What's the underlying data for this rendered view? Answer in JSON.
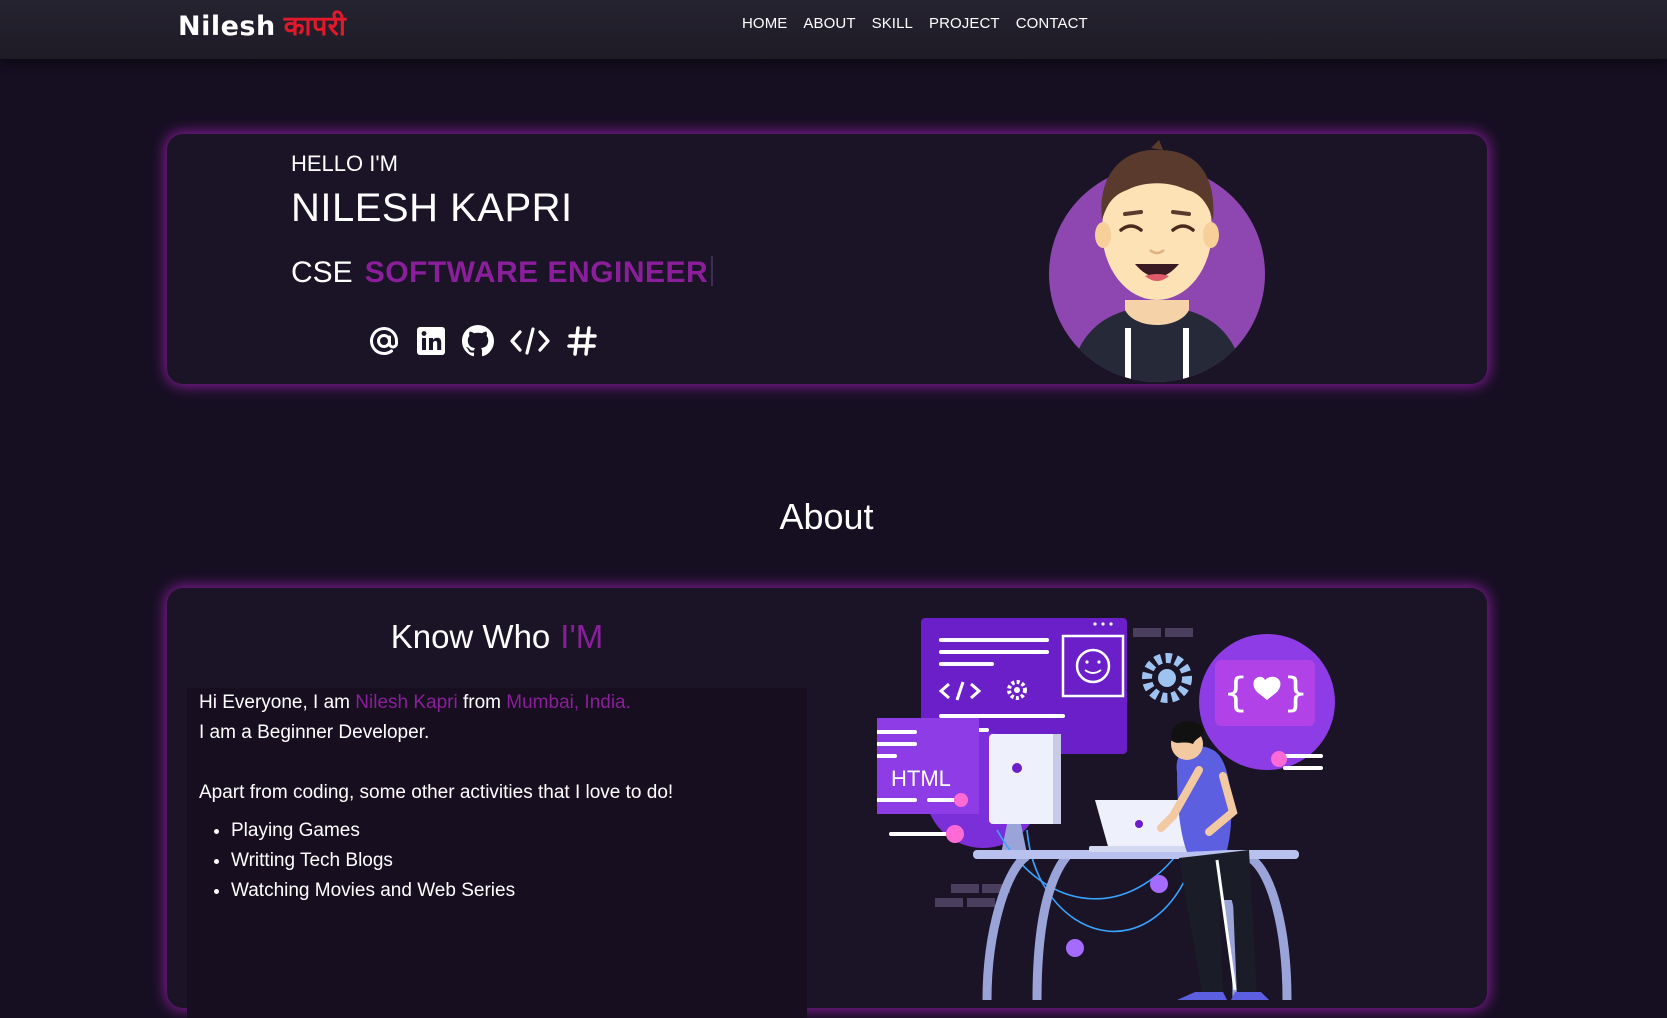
{
  "brand": {
    "first": "Nilesh",
    "last": "कापरी"
  },
  "nav": [
    "HOME",
    "ABOUT",
    "SKILL",
    "PROJECT",
    "CONTACT"
  ],
  "hero": {
    "greeting": "HELLO I'M",
    "name": "NILESH KAPRI",
    "role_prefix": "CSE",
    "role_typed": "SOFTWARE ENGINEER",
    "socials": [
      "at-icon",
      "linkedin-icon",
      "github-icon",
      "code-icon",
      "hashnode-icon"
    ]
  },
  "about": {
    "section_title": "About",
    "heading": "Know Who",
    "heading_accent": "I'M",
    "intro_prefix": "Hi Everyone, I am",
    "intro_name": "Nilesh Kapri",
    "intro_from": "from",
    "intro_place": "Mumbai, India.",
    "line2": "I am a Beginner Developer.",
    "activities_intro": "Apart from coding, some other activities that I love to do!",
    "activities": [
      "Playing Games",
      "Writting Tech Blogs",
      "Watching Movies and Web Series"
    ],
    "illustration_label": "HTML"
  },
  "colors": {
    "accent": "#8b1e9a",
    "brand_red": "#e3192b",
    "glow": "#b021c4",
    "bg": "#160f22"
  }
}
